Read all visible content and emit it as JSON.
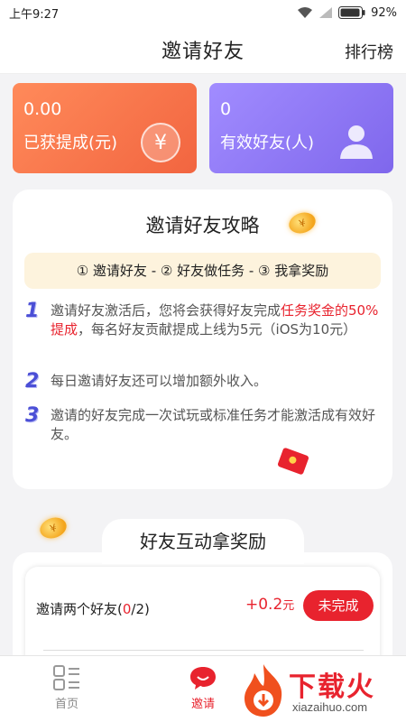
{
  "status_bar": {
    "time": "上午9:27",
    "battery": "92%"
  },
  "header": {
    "title": "邀请好友",
    "ranking_label": "排行榜"
  },
  "stats": {
    "money_value": "0.00",
    "money_label": "已获提成(元)",
    "money_symbol": "¥",
    "friends_value": "0",
    "friends_label": "有效好友(人)"
  },
  "strategy": {
    "title": "邀请好友攻略",
    "steps": "① 邀请好友 - ② 好友做任务 - ③ 我拿奖励",
    "tips": [
      {
        "num": "1",
        "text_a": "邀请好友激活后，您将会获得好友完成",
        "text_highlight": "任务奖金的50%提成",
        "text_b": "，每名好友贡献提成上线为5元（iOS为10元）"
      },
      {
        "num": "2",
        "text": "每日邀请好友还可以增加额外收入。"
      },
      {
        "num": "3",
        "text": "邀请的好友完成一次试玩或标准任务才能激活成有效好友。"
      }
    ]
  },
  "rewards": {
    "title": "好友互动拿奖励",
    "task": {
      "label_prefix": "邀请两个好友(",
      "progress_current": "0",
      "label_suffix": "/2)",
      "reward": "+0.2",
      "reward_unit": "元",
      "status": "未完成"
    }
  },
  "bottom_nav": {
    "items": [
      {
        "label": "首页"
      },
      {
        "label": "邀请"
      }
    ]
  },
  "watermark": {
    "text": "下载火",
    "sub": "xiazaihuo.com"
  },
  "colors": {
    "accent": "#e8232e",
    "money_card": "#f26540",
    "friends_card": "#7f67ec"
  }
}
